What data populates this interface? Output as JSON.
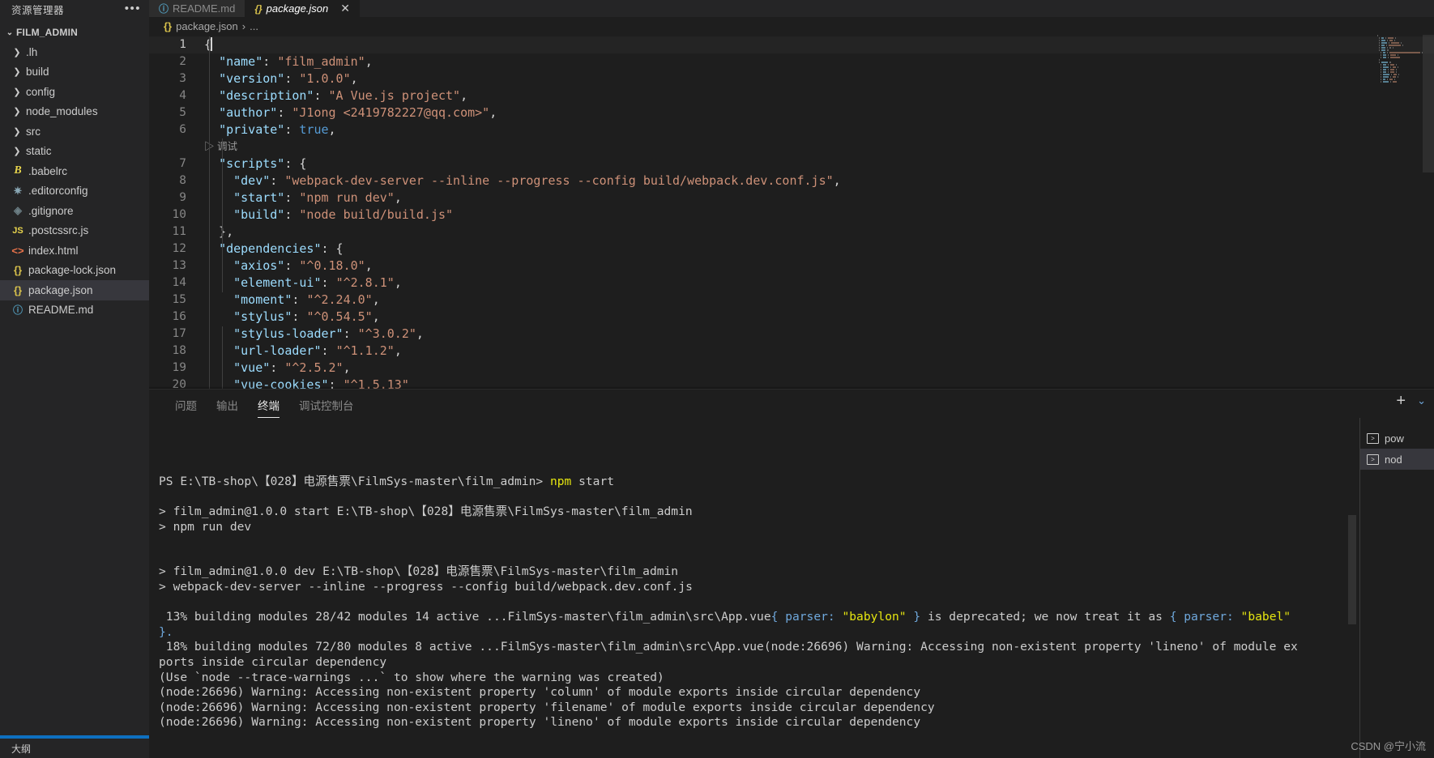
{
  "sidebar": {
    "title": "资源管理器",
    "more_icon": "ellipsis-icon",
    "project": "FILM_ADMIN",
    "items": [
      {
        "label": ".lh",
        "kind": "folder",
        "icon": "chevron-right-icon"
      },
      {
        "label": "build",
        "kind": "folder",
        "icon": "chevron-right-icon"
      },
      {
        "label": "config",
        "kind": "folder",
        "icon": "chevron-right-icon"
      },
      {
        "label": "node_modules",
        "kind": "folder",
        "icon": "chevron-right-icon"
      },
      {
        "label": "src",
        "kind": "folder",
        "icon": "chevron-right-icon"
      },
      {
        "label": "static",
        "kind": "folder",
        "icon": "chevron-right-icon"
      },
      {
        "label": ".babelrc",
        "kind": "file",
        "icon": "babel-icon",
        "glyph": "B"
      },
      {
        "label": ".editorconfig",
        "kind": "file",
        "icon": "gear-icon",
        "glyph": "✷"
      },
      {
        "label": ".gitignore",
        "kind": "file",
        "icon": "git-icon",
        "glyph": "◈"
      },
      {
        "label": ".postcssrc.js",
        "kind": "file",
        "icon": "js-icon",
        "glyph": "JS"
      },
      {
        "label": "index.html",
        "kind": "file",
        "icon": "html-icon",
        "glyph": "<>"
      },
      {
        "label": "package-lock.json",
        "kind": "file",
        "icon": "json-icon",
        "glyph": "{}"
      },
      {
        "label": "package.json",
        "kind": "file",
        "icon": "json-icon",
        "glyph": "{}",
        "selected": true
      },
      {
        "label": "README.md",
        "kind": "file",
        "icon": "info-icon",
        "glyph": "ⓘ"
      }
    ],
    "outline_label": "大纲"
  },
  "tabs": [
    {
      "label": "README.md",
      "icon": "info-icon",
      "glyph": "ⓘ",
      "active": false
    },
    {
      "label": "package.json",
      "icon": "json-icon",
      "glyph": "{}",
      "active": true,
      "close": "✕"
    }
  ],
  "breadcrumb": {
    "file_glyph": "{}",
    "file": "package.json",
    "sep": "›",
    "tail": "..."
  },
  "editor": {
    "codelens": "调试",
    "codelens_icon": "play-icon",
    "lines": [
      {
        "n": "1",
        "current": true,
        "tokens": [
          {
            "t": "{",
            "c": "brace"
          }
        ]
      },
      {
        "n": "2",
        "tokens": [
          {
            "t": "  ",
            "c": "pun"
          },
          {
            "t": "\"name\"",
            "c": "key"
          },
          {
            "t": ": ",
            "c": "pun"
          },
          {
            "t": "\"film_admin\"",
            "c": "str"
          },
          {
            "t": ",",
            "c": "pun"
          }
        ]
      },
      {
        "n": "3",
        "tokens": [
          {
            "t": "  ",
            "c": "pun"
          },
          {
            "t": "\"version\"",
            "c": "key"
          },
          {
            "t": ": ",
            "c": "pun"
          },
          {
            "t": "\"1.0.0\"",
            "c": "str"
          },
          {
            "t": ",",
            "c": "pun"
          }
        ]
      },
      {
        "n": "4",
        "tokens": [
          {
            "t": "  ",
            "c": "pun"
          },
          {
            "t": "\"description\"",
            "c": "key"
          },
          {
            "t": ": ",
            "c": "pun"
          },
          {
            "t": "\"A Vue.js project\"",
            "c": "str"
          },
          {
            "t": ",",
            "c": "pun"
          }
        ]
      },
      {
        "n": "5",
        "tokens": [
          {
            "t": "  ",
            "c": "pun"
          },
          {
            "t": "\"author\"",
            "c": "key"
          },
          {
            "t": ": ",
            "c": "pun"
          },
          {
            "t": "\"J1ong <2419782227@qq.com>\"",
            "c": "str"
          },
          {
            "t": ",",
            "c": "pun"
          }
        ]
      },
      {
        "n": "6",
        "tokens": [
          {
            "t": "  ",
            "c": "pun"
          },
          {
            "t": "\"private\"",
            "c": "key"
          },
          {
            "t": ": ",
            "c": "pun"
          },
          {
            "t": "true",
            "c": "bool"
          },
          {
            "t": ",",
            "c": "pun"
          }
        ]
      },
      {
        "n": "7",
        "tokens": [
          {
            "t": "  ",
            "c": "pun"
          },
          {
            "t": "\"scripts\"",
            "c": "key"
          },
          {
            "t": ": {",
            "c": "pun"
          }
        ]
      },
      {
        "n": "8",
        "tokens": [
          {
            "t": "    ",
            "c": "pun"
          },
          {
            "t": "\"dev\"",
            "c": "key"
          },
          {
            "t": ": ",
            "c": "pun"
          },
          {
            "t": "\"webpack-dev-server --inline --progress --config build/webpack.dev.conf.js\"",
            "c": "str"
          },
          {
            "t": ",",
            "c": "pun"
          }
        ]
      },
      {
        "n": "9",
        "tokens": [
          {
            "t": "    ",
            "c": "pun"
          },
          {
            "t": "\"start\"",
            "c": "key"
          },
          {
            "t": ": ",
            "c": "pun"
          },
          {
            "t": "\"npm run dev\"",
            "c": "str"
          },
          {
            "t": ",",
            "c": "pun"
          }
        ]
      },
      {
        "n": "10",
        "tokens": [
          {
            "t": "    ",
            "c": "pun"
          },
          {
            "t": "\"build\"",
            "c": "key"
          },
          {
            "t": ": ",
            "c": "pun"
          },
          {
            "t": "\"node build/build.js\"",
            "c": "str"
          }
        ]
      },
      {
        "n": "11",
        "tokens": [
          {
            "t": "  },",
            "c": "pun"
          }
        ]
      },
      {
        "n": "12",
        "tokens": [
          {
            "t": "  ",
            "c": "pun"
          },
          {
            "t": "\"dependencies\"",
            "c": "key"
          },
          {
            "t": ": {",
            "c": "pun"
          }
        ]
      },
      {
        "n": "13",
        "tokens": [
          {
            "t": "    ",
            "c": "pun"
          },
          {
            "t": "\"axios\"",
            "c": "key"
          },
          {
            "t": ": ",
            "c": "pun"
          },
          {
            "t": "\"^0.18.0\"",
            "c": "str"
          },
          {
            "t": ",",
            "c": "pun"
          }
        ]
      },
      {
        "n": "14",
        "tokens": [
          {
            "t": "    ",
            "c": "pun"
          },
          {
            "t": "\"element-ui\"",
            "c": "key"
          },
          {
            "t": ": ",
            "c": "pun"
          },
          {
            "t": "\"^2.8.1\"",
            "c": "str"
          },
          {
            "t": ",",
            "c": "pun"
          }
        ]
      },
      {
        "n": "15",
        "tokens": [
          {
            "t": "    ",
            "c": "pun"
          },
          {
            "t": "\"moment\"",
            "c": "key"
          },
          {
            "t": ": ",
            "c": "pun"
          },
          {
            "t": "\"^2.24.0\"",
            "c": "str"
          },
          {
            "t": ",",
            "c": "pun"
          }
        ]
      },
      {
        "n": "16",
        "tokens": [
          {
            "t": "    ",
            "c": "pun"
          },
          {
            "t": "\"stylus\"",
            "c": "key"
          },
          {
            "t": ": ",
            "c": "pun"
          },
          {
            "t": "\"^0.54.5\"",
            "c": "str"
          },
          {
            "t": ",",
            "c": "pun"
          }
        ]
      },
      {
        "n": "17",
        "tokens": [
          {
            "t": "    ",
            "c": "pun"
          },
          {
            "t": "\"stylus-loader\"",
            "c": "key"
          },
          {
            "t": ": ",
            "c": "pun"
          },
          {
            "t": "\"^3.0.2\"",
            "c": "str"
          },
          {
            "t": ",",
            "c": "pun"
          }
        ]
      },
      {
        "n": "18",
        "tokens": [
          {
            "t": "    ",
            "c": "pun"
          },
          {
            "t": "\"url-loader\"",
            "c": "key"
          },
          {
            "t": ": ",
            "c": "pun"
          },
          {
            "t": "\"^1.1.2\"",
            "c": "str"
          },
          {
            "t": ",",
            "c": "pun"
          }
        ]
      },
      {
        "n": "19",
        "tokens": [
          {
            "t": "    ",
            "c": "pun"
          },
          {
            "t": "\"vue\"",
            "c": "key"
          },
          {
            "t": ": ",
            "c": "pun"
          },
          {
            "t": "\"^2.5.2\"",
            "c": "str"
          },
          {
            "t": ",",
            "c": "pun"
          }
        ]
      },
      {
        "n": "20",
        "tokens": [
          {
            "t": "    ",
            "c": "pun"
          },
          {
            "t": "\"vue-cookies\"",
            "c": "key"
          },
          {
            "t": ": ",
            "c": "pun"
          },
          {
            "t": "\"^1.5.13\"",
            "c": "str"
          }
        ]
      }
    ]
  },
  "panel": {
    "tabs": [
      {
        "label": "问题",
        "active": false
      },
      {
        "label": "输出",
        "active": false
      },
      {
        "label": "终端",
        "active": true
      },
      {
        "label": "调试控制台",
        "active": false
      }
    ],
    "actions": [
      {
        "icon": "plus-icon",
        "glyph": "+"
      },
      {
        "icon": "chevron-down-icon",
        "glyph": "⌄"
      }
    ],
    "terminal_tabs": [
      {
        "label": "pow",
        "icon": "terminal-icon",
        "glyph": ">_",
        "active": false
      },
      {
        "label": "nod",
        "icon": "terminal-icon",
        "glyph": ">_",
        "active": true
      }
    ],
    "terminal_lines": [
      {
        "segments": [
          {
            "t": "PS E:\\TB-shop\\【028】电源售票\\FilmSys-master\\film_admin> ",
            "c": "plain"
          },
          {
            "t": "npm",
            "c": "yellow"
          },
          {
            "t": " start",
            "c": "plain"
          }
        ]
      },
      {
        "segments": [
          {
            "t": "",
            "c": "plain"
          }
        ]
      },
      {
        "segments": [
          {
            "t": "> film_admin@1.0.0 start E:\\TB-shop\\【028】电源售票\\FilmSys-master\\film_admin",
            "c": "plain"
          }
        ]
      },
      {
        "segments": [
          {
            "t": "> npm run dev",
            "c": "plain"
          }
        ]
      },
      {
        "segments": [
          {
            "t": "",
            "c": "plain"
          }
        ]
      },
      {
        "segments": [
          {
            "t": "",
            "c": "plain"
          }
        ]
      },
      {
        "segments": [
          {
            "t": "> film_admin@1.0.0 dev E:\\TB-shop\\【028】电源售票\\FilmSys-master\\film_admin",
            "c": "plain"
          }
        ]
      },
      {
        "segments": [
          {
            "t": "> webpack-dev-server --inline --progress --config build/webpack.dev.conf.js",
            "c": "plain"
          }
        ]
      },
      {
        "segments": [
          {
            "t": "",
            "c": "plain"
          }
        ]
      },
      {
        "segments": [
          {
            "t": " 13% building modules 28/42 modules 14 active ...FilmSys-master\\film_admin\\src\\App.vue",
            "c": "plain"
          },
          {
            "t": "{ parser:",
            "c": "blue"
          },
          {
            "t": " \"babylon\"",
            "c": "yellow"
          },
          {
            "t": " }",
            "c": "blue"
          },
          {
            "t": " is deprecated; we now treat it as ",
            "c": "plain"
          },
          {
            "t": "{ parser:",
            "c": "blue"
          },
          {
            "t": " \"babel\"",
            "c": "yellow"
          }
        ]
      },
      {
        "segments": [
          {
            "t": "}.",
            "c": "blue"
          }
        ]
      },
      {
        "segments": [
          {
            "t": " 18% building modules 72/80 modules 8 active ...FilmSys-master\\film_admin\\src\\App.vue(node:26696) Warning: Accessing non-existent property 'lineno' of module ex",
            "c": "plain"
          }
        ]
      },
      {
        "segments": [
          {
            "t": "ports inside circular dependency",
            "c": "plain"
          }
        ]
      },
      {
        "segments": [
          {
            "t": "(Use `node --trace-warnings ...` to show where the warning was created)",
            "c": "plain"
          }
        ]
      },
      {
        "segments": [
          {
            "t": "(node:26696) Warning: Accessing non-existent property 'column' of module exports inside circular dependency",
            "c": "plain"
          }
        ]
      },
      {
        "segments": [
          {
            "t": "(node:26696) Warning: Accessing non-existent property 'filename' of module exports inside circular dependency",
            "c": "plain"
          }
        ]
      },
      {
        "segments": [
          {
            "t": "(node:26696) Warning: Accessing non-existent property 'lineno' of module exports inside circular dependency",
            "c": "plain"
          }
        ]
      }
    ]
  },
  "watermark": "CSDN @宁小流",
  "colors": {
    "accent": "#0e70c0",
    "editor_bg": "#1e1e1e",
    "sidebar_bg": "#252526",
    "selection": "#37373d",
    "string": "#ce9178",
    "key": "#9cdcfe",
    "bool": "#569cd6",
    "terminal_yellow": "#e5e510",
    "terminal_blue": "#6fa8dc"
  }
}
